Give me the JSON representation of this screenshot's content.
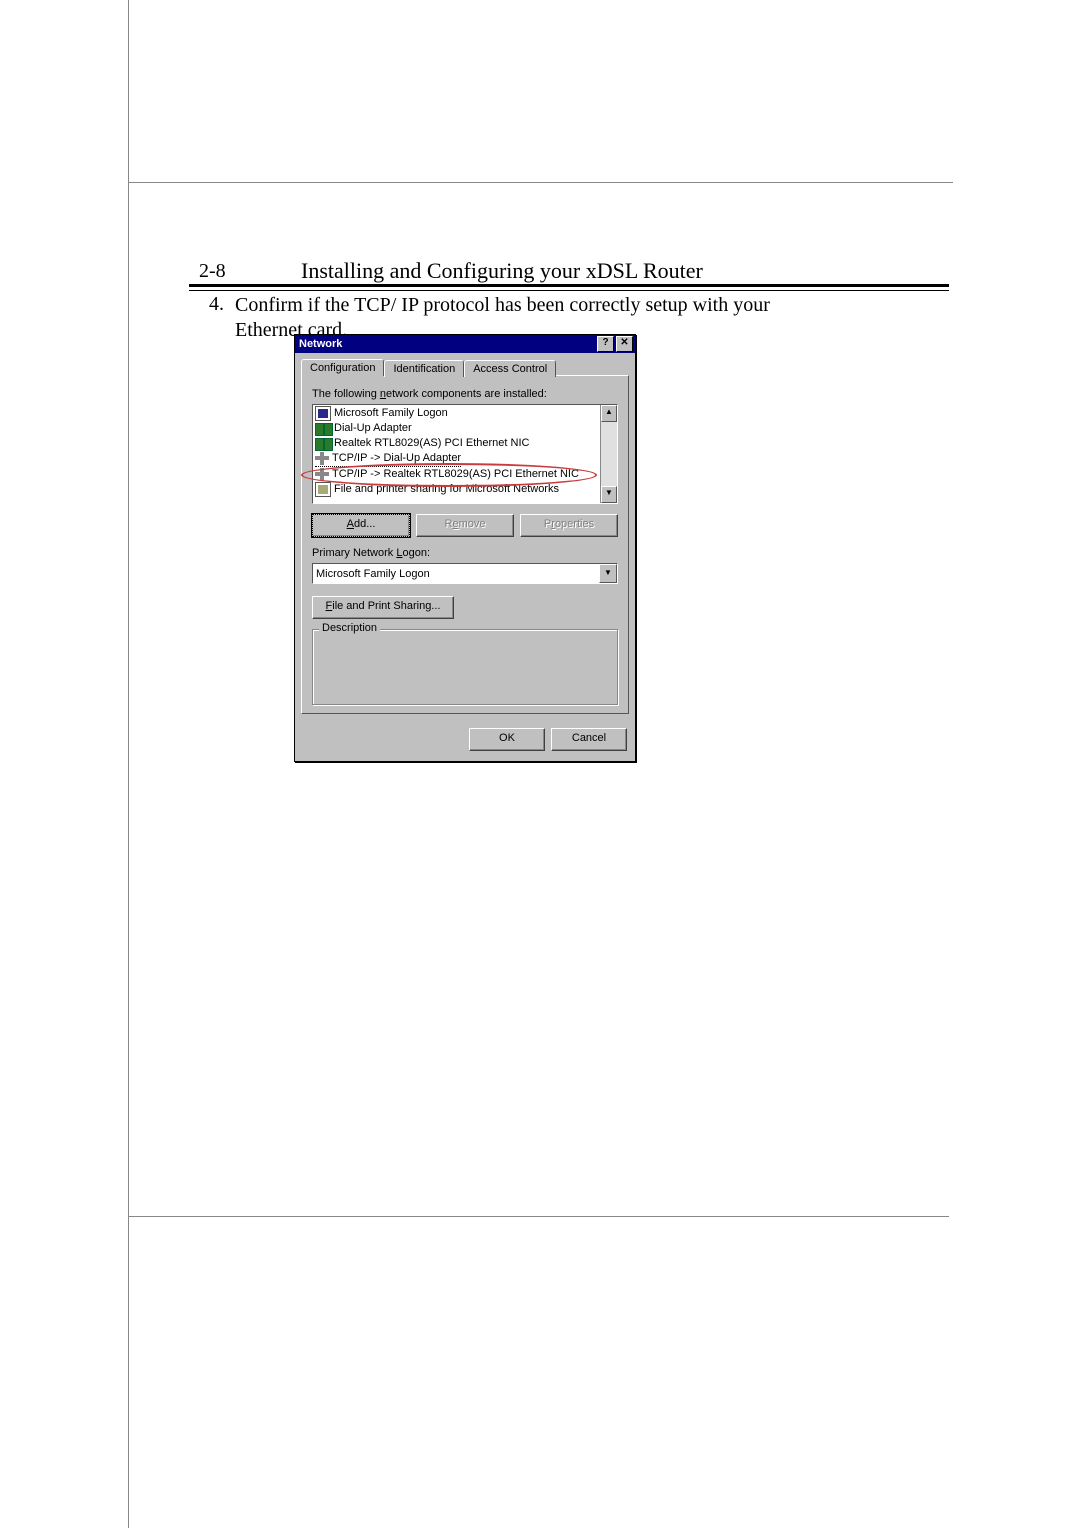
{
  "doc": {
    "page_number": "2-8",
    "page_header": "Installing and Configuring your xDSL Router",
    "step_number": "4.",
    "step_text": "Confirm if the TCP/ IP protocol has been correctly setup with your Ethernet card."
  },
  "dialog": {
    "title": "Network",
    "help_glyph": "?",
    "close_glyph": "✕",
    "tabs": {
      "configuration": "Configuration",
      "identification": "Identification",
      "access_control": "Access Control"
    },
    "components_label_pre": "The following ",
    "components_label_u": "n",
    "components_label_post": "etwork components are installed:",
    "list": [
      "Microsoft Family Logon",
      "Dial-Up Adapter",
      "Realtek RTL8029(AS) PCI Ethernet NIC",
      "TCP/IP -> Dial-Up Adapter",
      "TCP/IP -> Realtek RTL8029(AS) PCI Ethernet NIC",
      "File and printer sharing for Microsoft Networks"
    ],
    "scroll_up": "▲",
    "scroll_down": "▼",
    "buttons": {
      "add_u": "A",
      "add_rest": "dd...",
      "remove": "Remove",
      "remove_u": "e",
      "properties": "Properties",
      "properties_u": "r",
      "file_print_pre": "",
      "file_print_u": "F",
      "file_print_rest": "ile and Print Sharing...",
      "ok": "OK",
      "cancel": "Cancel"
    },
    "primary_logon_label_pre": "Primary Network ",
    "primary_logon_label_u": "L",
    "primary_logon_label_post": "ogon:",
    "primary_logon_value": "Microsoft Family Logon",
    "combo_glyph": "▼",
    "description_label": "Description"
  }
}
